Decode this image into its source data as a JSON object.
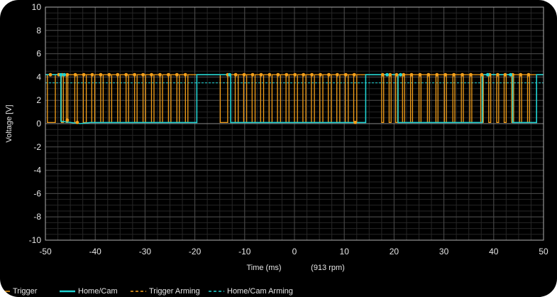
{
  "colors": {
    "background": "#000000",
    "plot_background": "#000000",
    "grid": "#4a4a4a",
    "axis_frame": "#b0b0b0",
    "trigger": "#f5a01a",
    "homecam": "#1fd2d2",
    "trigger_arming": "#f5a01a",
    "homecam_arming": "#1fd2d2"
  },
  "chart_data": {
    "type": "line",
    "xlabel": "Time (ms)",
    "xlabel_note": "(913 rpm)",
    "ylabel": "Voltage [V]",
    "xlim": [
      -50,
      50
    ],
    "ylim": [
      -10,
      10
    ],
    "x_ticks": [
      "-50",
      "-40",
      "-30",
      "-20",
      "-10",
      "0",
      "10",
      "20",
      "30",
      "40",
      "50"
    ],
    "y_ticks": [
      "10",
      "8",
      "6",
      "4",
      "2",
      "0",
      "-2",
      "-4",
      "-6",
      "-8",
      "-10"
    ],
    "grid": true,
    "legend_position": "bottom",
    "series": [
      {
        "name": "Trigger",
        "style": "line-with-markers",
        "color": "#f5a01a",
        "high": 4.2,
        "low": 0.1,
        "pulses": [
          [
            -49.6,
            -48.0
          ],
          [
            -46.8,
            -46.4
          ],
          [
            -45.8,
            -45.5
          ],
          [
            -44.1,
            -43.6
          ],
          [
            -42.4,
            -41.8
          ],
          [
            -40.7,
            -40.1
          ],
          [
            -38.9,
            -38.4
          ],
          [
            -37.2,
            -36.7
          ],
          [
            -35.5,
            -35.0
          ],
          [
            -33.8,
            -33.3
          ],
          [
            -32.1,
            -31.6
          ],
          [
            -30.4,
            -29.9
          ],
          [
            -28.7,
            -28.2
          ],
          [
            -27.0,
            -26.5
          ],
          [
            -25.3,
            -24.8
          ],
          [
            -23.6,
            -23.1
          ],
          [
            -21.9,
            -21.4
          ],
          [
            -14.9,
            -13.4
          ],
          [
            -11.9,
            -11.3
          ],
          [
            -10.2,
            -9.6
          ],
          [
            -8.5,
            -7.9
          ],
          [
            -6.8,
            -6.2
          ],
          [
            -5.1,
            -4.5
          ],
          [
            -3.4,
            -2.8
          ],
          [
            -1.7,
            -1.1
          ],
          [
            0.0,
            0.6
          ],
          [
            1.7,
            2.3
          ],
          [
            3.4,
            4.0
          ],
          [
            5.1,
            5.7
          ],
          [
            6.8,
            7.4
          ],
          [
            8.5,
            9.1
          ],
          [
            10.2,
            10.8
          ],
          [
            11.9,
            12.5
          ],
          [
            17.5,
            17.9
          ],
          [
            19.0,
            19.4
          ],
          [
            20.3,
            20.7
          ],
          [
            21.7,
            22.1
          ],
          [
            23.3,
            23.7
          ],
          [
            25.0,
            25.4
          ],
          [
            26.7,
            27.1
          ],
          [
            28.4,
            28.8
          ],
          [
            30.1,
            30.5
          ],
          [
            31.8,
            32.2
          ],
          [
            33.5,
            33.9
          ],
          [
            35.2,
            35.6
          ],
          [
            37.4,
            37.9
          ],
          [
            39.0,
            39.4
          ],
          [
            40.6,
            41.0
          ],
          [
            42.1,
            42.5
          ],
          [
            43.6,
            44.0
          ],
          [
            45.2,
            45.6
          ],
          [
            46.8,
            47.2
          ]
        ],
        "markers": [
          [
            -49.0,
            4.2
          ],
          [
            -47.3,
            4.2
          ],
          [
            -46.6,
            4.2
          ],
          [
            -45.6,
            4.2
          ],
          [
            -44.0,
            4.2
          ],
          [
            -42.3,
            4.2
          ],
          [
            -40.6,
            4.2
          ],
          [
            -38.9,
            4.2
          ],
          [
            -37.2,
            4.2
          ],
          [
            -35.5,
            4.2
          ],
          [
            -33.8,
            4.2
          ],
          [
            -32.1,
            4.2
          ],
          [
            -30.4,
            4.2
          ],
          [
            -28.7,
            4.2
          ],
          [
            -27.0,
            4.2
          ],
          [
            -25.3,
            4.2
          ],
          [
            -23.6,
            4.2
          ],
          [
            -21.9,
            4.2
          ],
          [
            -45.6,
            0.3
          ],
          [
            -43.6,
            0.1
          ],
          [
            -10.1,
            4.2
          ],
          [
            -8.4,
            4.2
          ],
          [
            -6.7,
            4.2
          ],
          [
            -5.0,
            4.2
          ],
          [
            -3.3,
            4.2
          ],
          [
            -1.6,
            4.2
          ],
          [
            0.1,
            4.2
          ],
          [
            1.8,
            4.2
          ],
          [
            3.5,
            4.2
          ],
          [
            5.2,
            4.2
          ],
          [
            6.9,
            4.2
          ],
          [
            8.6,
            4.2
          ],
          [
            10.3,
            4.2
          ],
          [
            12.0,
            4.2
          ],
          [
            12.2,
            0.1
          ],
          [
            -13.4,
            4.2
          ],
          [
            -11.8,
            4.2
          ],
          [
            17.7,
            4.2
          ],
          [
            19.2,
            4.2
          ],
          [
            20.5,
            4.2
          ],
          [
            21.9,
            4.2
          ],
          [
            23.5,
            4.2
          ],
          [
            25.2,
            4.2
          ],
          [
            26.9,
            4.2
          ],
          [
            28.6,
            4.2
          ],
          [
            30.3,
            4.2
          ],
          [
            32.0,
            4.2
          ],
          [
            33.7,
            4.2
          ],
          [
            35.4,
            4.2
          ],
          [
            37.6,
            4.2
          ],
          [
            39.2,
            4.2
          ],
          [
            40.8,
            4.2
          ],
          [
            42.3,
            4.2
          ],
          [
            43.8,
            4.2
          ],
          [
            45.4,
            4.2
          ],
          [
            47.0,
            4.2
          ]
        ]
      },
      {
        "name": "Home/Cam",
        "style": "line",
        "color": "#1fd2d2",
        "points": [
          [
            -50,
            4.2
          ],
          [
            -46.9,
            4.2
          ],
          [
            -46.9,
            0.2
          ],
          [
            -43.0,
            0.0
          ],
          [
            -41.0,
            0.1
          ],
          [
            -19.6,
            0.1
          ],
          [
            -19.6,
            4.2
          ],
          [
            -12.8,
            4.2
          ],
          [
            -12.8,
            0.1
          ],
          [
            14.3,
            0.1
          ],
          [
            14.3,
            4.2
          ],
          [
            20.8,
            4.2
          ],
          [
            20.8,
            0.1
          ],
          [
            37.7,
            0.1
          ],
          [
            37.7,
            4.2
          ],
          [
            43.8,
            4.2
          ],
          [
            43.8,
            0.1
          ],
          [
            48.6,
            0.1
          ],
          [
            48.6,
            4.2
          ],
          [
            50,
            4.2
          ]
        ],
        "markers": [
          [
            -46.2,
            4.2
          ],
          [
            -46.9,
            4.2
          ],
          [
            -13.0,
            4.2
          ],
          [
            18.6,
            4.2
          ],
          [
            21.3,
            4.2
          ],
          [
            38.8,
            4.2
          ],
          [
            43.4,
            4.2
          ]
        ]
      },
      {
        "name": "Trigger Arming",
        "style": "dashed",
        "color": "#f5a01a",
        "y": 4.2
      },
      {
        "name": "Home/Cam Arming",
        "style": "dashed",
        "color": "#1fd2d2",
        "y": 3.5
      }
    ]
  },
  "legend": [
    {
      "label": "Trigger",
      "kind": "line-marker",
      "color": "#f5a01a"
    },
    {
      "label": "Home/Cam",
      "kind": "line",
      "color": "#1fd2d2"
    },
    {
      "label": "Trigger Arming",
      "kind": "dash",
      "color": "#f5a01a"
    },
    {
      "label": "Home/Cam Arming",
      "kind": "dash",
      "color": "#1fd2d2"
    }
  ]
}
